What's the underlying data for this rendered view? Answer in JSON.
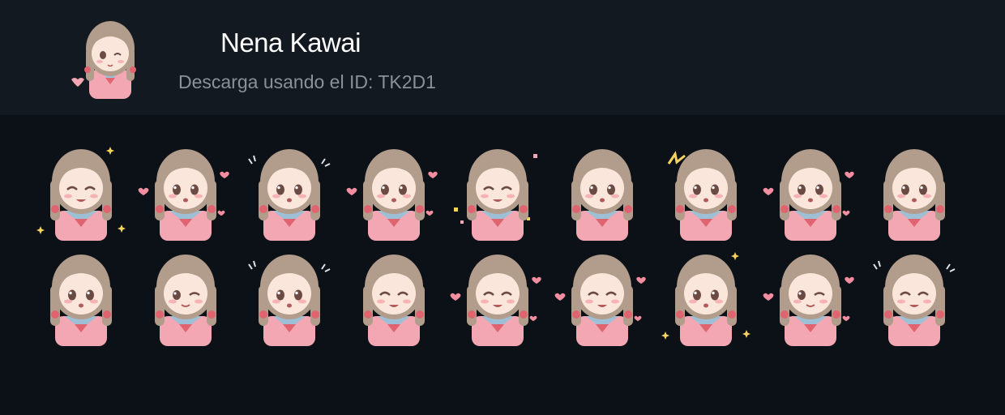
{
  "pack": {
    "title": "Nena Kawai",
    "subtitle": "Descarga usando el ID: TK2D1",
    "icon": "anime-girl-wink-heart-sticker"
  },
  "colors": {
    "background": "#0c1118",
    "header": "#121920",
    "title": "#ffffff",
    "subtitle": "#8b9199",
    "hair": "#b29c8c",
    "skin": "#fbe6dc",
    "cardigan": "#f2a7b3",
    "collar": "#9ec0d6",
    "bow": "#e0646f"
  },
  "stickers": [
    {
      "name": "sticker-cheer-fist",
      "expr": "happy",
      "deco": "stars"
    },
    {
      "name": "sticker-surprised-hearts",
      "expr": "open",
      "deco": "hearts"
    },
    {
      "name": "sticker-shy-side",
      "expr": "open",
      "deco": "lines"
    },
    {
      "name": "sticker-hands-on-head",
      "expr": "open",
      "deco": "hearts"
    },
    {
      "name": "sticker-hooray-confetti",
      "expr": "happy",
      "deco": "confetti"
    },
    {
      "name": "sticker-blush-chin",
      "expr": "open",
      "deco": "none"
    },
    {
      "name": "sticker-surprised-spark",
      "expr": "open",
      "deco": "spark"
    },
    {
      "name": "sticker-praying-hearts",
      "expr": "open",
      "deco": "hearts"
    },
    {
      "name": "sticker-joy-cheeks",
      "expr": "open",
      "deco": "none"
    },
    {
      "name": "sticker-salute",
      "expr": "open",
      "deco": "none"
    },
    {
      "name": "sticker-crying-pajamas",
      "expr": "wink",
      "deco": "none"
    },
    {
      "name": "sticker-nervous",
      "expr": "open",
      "deco": "lines"
    },
    {
      "name": "sticker-arms-crossed",
      "expr": "happy",
      "deco": "none"
    },
    {
      "name": "sticker-happy-hearts",
      "expr": "happy",
      "deco": "hearts"
    },
    {
      "name": "sticker-bunny-plush",
      "expr": "happy",
      "deco": "hearts"
    },
    {
      "name": "sticker-excited-sparkles",
      "expr": "open",
      "deco": "stars"
    },
    {
      "name": "sticker-wink-heart",
      "expr": "wink",
      "deco": "hearts"
    },
    {
      "name": "sticker-laughing-wave",
      "expr": "happy",
      "deco": "lines"
    }
  ]
}
